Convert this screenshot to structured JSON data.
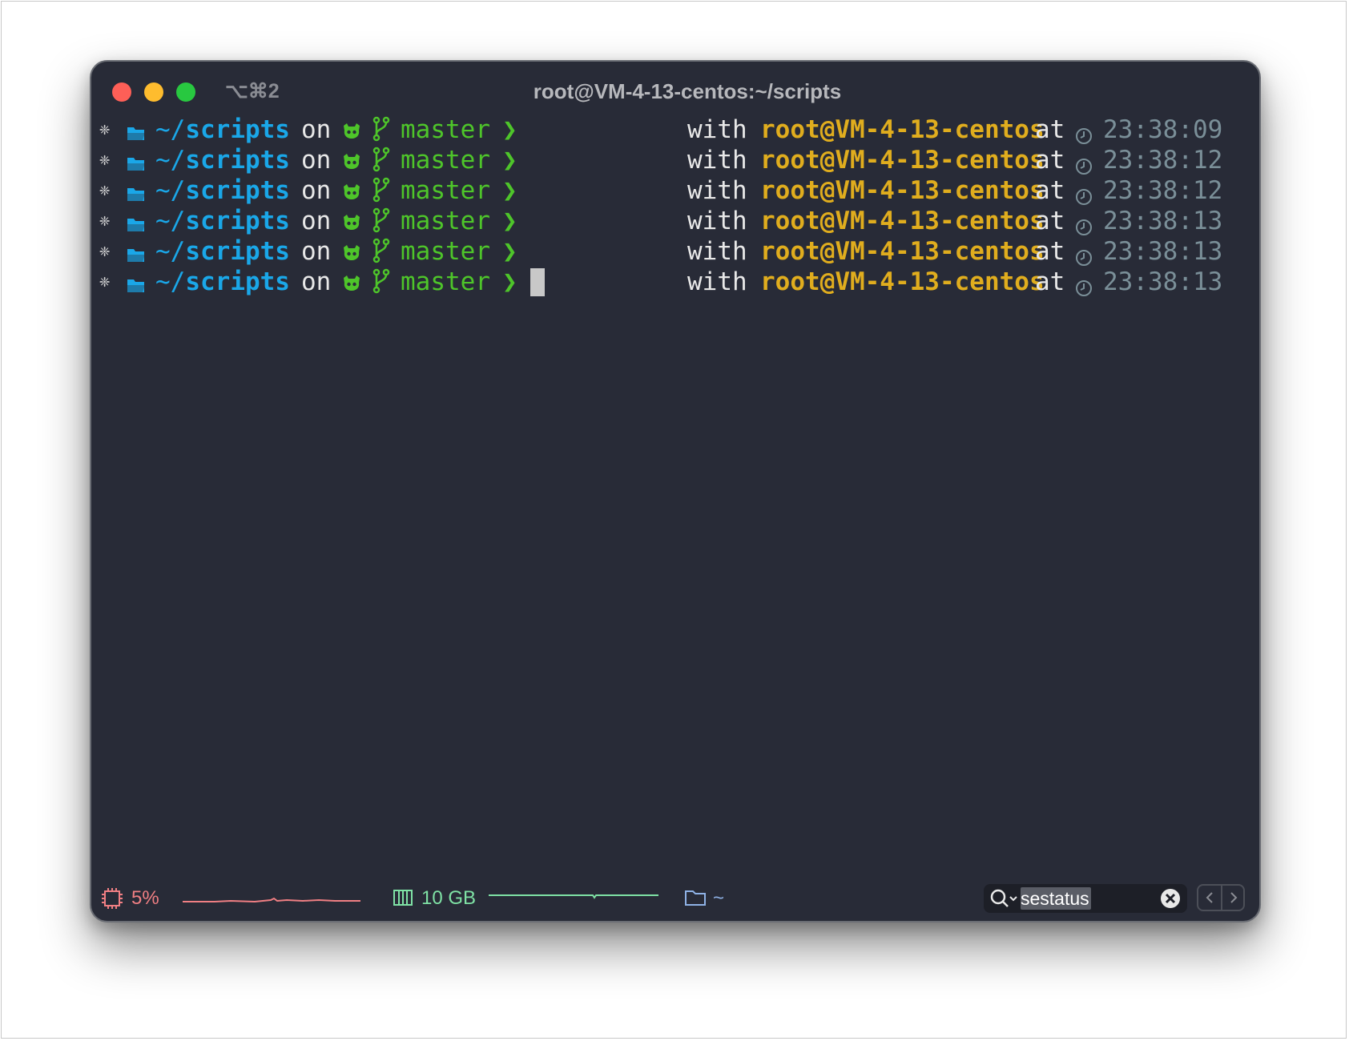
{
  "window": {
    "shortcut": "⌥⌘2",
    "title": "root@VM-4-13-centos:~/scripts"
  },
  "prompt": {
    "path_prefix": "~/",
    "path_dir": "scripts",
    "on": "on",
    "branch": "master",
    "chevron": "❯",
    "with": "with",
    "host": "root@VM-4-13-centos",
    "at": "at",
    "os_icon": "centos-icon",
    "folder_icon": "folder-open-icon",
    "git_icon": "github-icon",
    "branch_icon": "git-branch-icon",
    "clock_icon": "clock-icon"
  },
  "lines": [
    {
      "time": "23:38:09"
    },
    {
      "time": "23:38:12"
    },
    {
      "time": "23:38:12"
    },
    {
      "time": "23:38:13"
    },
    {
      "time": "23:38:13"
    },
    {
      "time": "23:38:13"
    }
  ],
  "statusbar": {
    "cpu": "5%",
    "memory": "10 GB",
    "directory": "~",
    "search_value": "sestatus"
  },
  "colors": {
    "background": "#282b37",
    "path": "#1aa7e8",
    "branch": "#4ec52a",
    "host": "#e0ad1e",
    "time": "#7a8f98",
    "cpu": "#f07f83",
    "memory": "#7fe2a5"
  }
}
